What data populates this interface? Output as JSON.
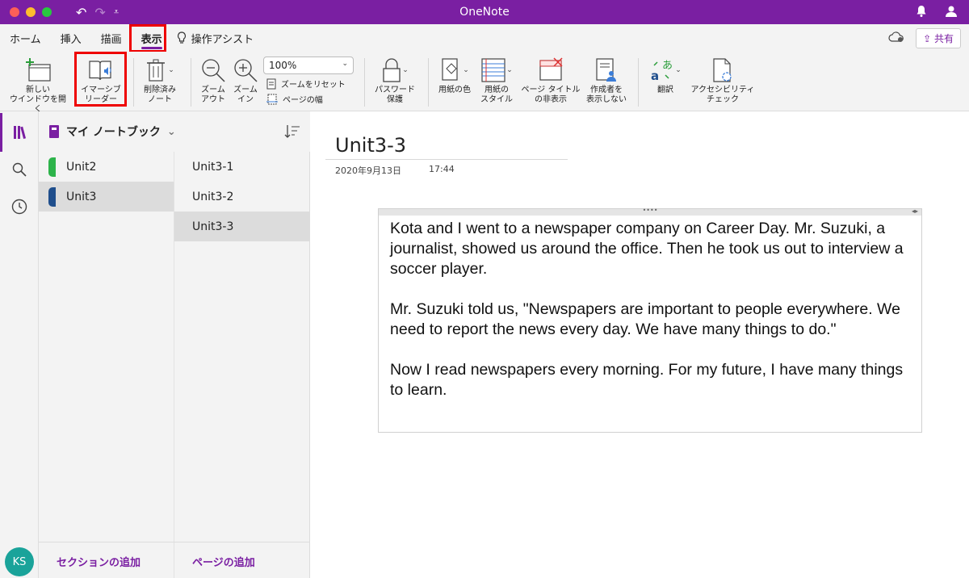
{
  "window": {
    "title": "OneNote"
  },
  "tabs": [
    {
      "label": "ホーム"
    },
    {
      "label": "挿入"
    },
    {
      "label": "描画"
    },
    {
      "label": "表示"
    }
  ],
  "assist_label": "操作アシスト",
  "share_label": "共有",
  "ribbon": {
    "new_window": [
      "新しい",
      "ウインドウを開く"
    ],
    "immersive_reader": [
      "イマーシブ",
      "リーダー"
    ],
    "deleted_notes": [
      "削除済み",
      "ノート"
    ],
    "zoom_out": [
      "ズーム",
      "アウト"
    ],
    "zoom_in": [
      "ズーム",
      "イン"
    ],
    "zoom_value": "100%",
    "zoom_reset": "ズームをリセット",
    "page_width": "ページの幅",
    "password": [
      "パスワード",
      "保護"
    ],
    "paper_color": "用紙の色",
    "paper_style": [
      "用紙の",
      "スタイル"
    ],
    "hide_title": [
      "ページ タイトル",
      "の非表示"
    ],
    "hide_authors": [
      "作成者を",
      "表示しない"
    ],
    "translate": "翻訳",
    "accessibility": [
      "アクセシビリティ",
      "チェック"
    ]
  },
  "notebook": {
    "name": "マイ ノートブック"
  },
  "sections": [
    {
      "label": "Unit2",
      "color": "#2db34a"
    },
    {
      "label": "Unit3",
      "color": "#1f4e8c"
    }
  ],
  "pages": [
    {
      "label": "Unit3-1"
    },
    {
      "label": "Unit3-2"
    },
    {
      "label": "Unit3-3"
    }
  ],
  "add_section": "セクションの追加",
  "add_page": "ページの追加",
  "user_initials": "KS",
  "page": {
    "title": "Unit3-3",
    "date": "2020年9月13日",
    "time": "17:44",
    "paragraphs": [
      "Kota and I went to a newspaper company on Career Day. Mr. Suzuki, a journalist, showed us around the office. Then he took us out to interview a soccer player.",
      "Mr. Suzuki told us, \"Newspapers are important to people everywhere. We need to report the news every day. We have many things to do.\"",
      "Now I read newspapers every morning. For my future, I have many things to learn."
    ]
  },
  "colors": {
    "accent": "#7a1fa2",
    "highlight": "#e00000"
  }
}
